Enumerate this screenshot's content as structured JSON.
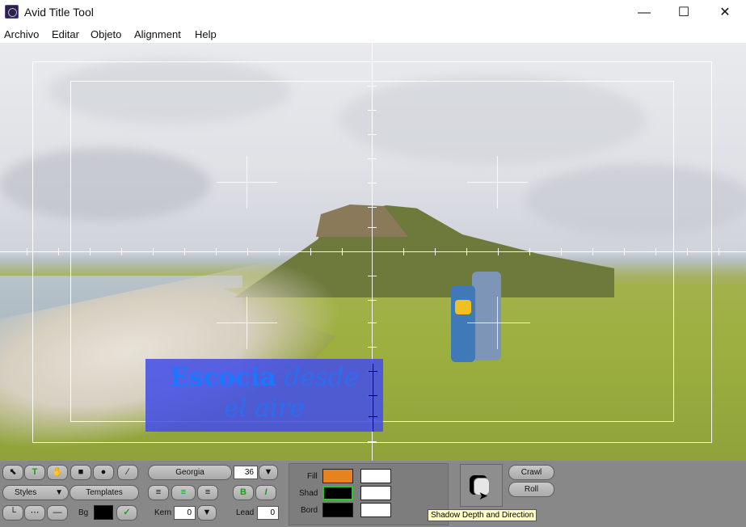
{
  "window": {
    "title": "Avid Title Tool",
    "minimize_glyph": "—",
    "maximize_glyph": "☐",
    "close_glyph": "✕"
  },
  "menu": [
    "Archivo",
    "Editar",
    "Objeto",
    "Alignment",
    "Help"
  ],
  "canvas": {
    "title_line1_bold": "Escocia",
    "title_line1_italic": "desde",
    "title_line2_italic": "el aire"
  },
  "toolbar": {
    "tools": [
      "pointer-icon",
      "text-tool-icon",
      "hand-icon",
      "rectangle-icon",
      "ellipse-icon",
      "line-icon"
    ],
    "styles_label": "Styles",
    "templates_label": "Templates",
    "font_name": "Georgia",
    "font_size": "36",
    "bg_label": "Bg",
    "kern_label": "Kern",
    "kern_value": "0",
    "lead_label": "Lead",
    "lead_value": "0",
    "fill_label": "Fill",
    "shad_label": "Shad",
    "bord_label": "Bord",
    "crawl_label": "Crawl",
    "roll_label": "Roll",
    "tooltip": "Shadow Depth and Direction",
    "colors": {
      "fill": "#e8821e",
      "shadow": "#000000",
      "border": "#000000",
      "bg": "#000000",
      "accent_green": "#22cc22"
    }
  }
}
